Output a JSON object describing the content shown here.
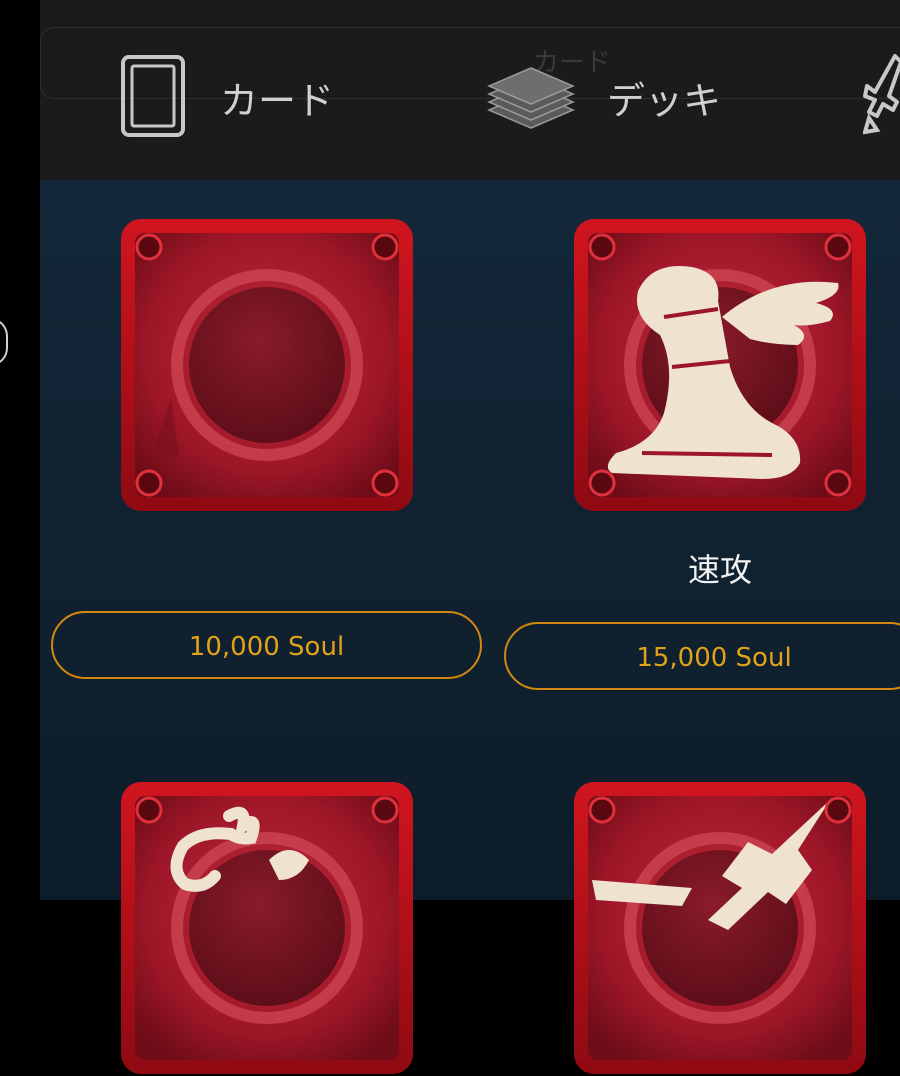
{
  "tabs": [
    {
      "label": "カード",
      "icon": "card-icon"
    },
    {
      "label": "デッキ",
      "icon": "deck-icon"
    },
    {
      "label": "",
      "icon": "sword-icon"
    }
  ],
  "search": {
    "placeholder": "カード"
  },
  "skills": [
    {
      "name": "",
      "price": "10,000 Soul",
      "icon": "blank-skill-icon"
    },
    {
      "name": "速攻",
      "price": "15,000 Soul",
      "icon": "winged-boot-icon"
    },
    {
      "name": "",
      "price": "",
      "icon": "scorpion-icon"
    },
    {
      "name": "",
      "price": "",
      "icon": "dagger-icon"
    }
  ],
  "colors": {
    "accent": "#d4880f",
    "price_text": "#e0a21b",
    "frame_red": "#b3101b",
    "background": "#102130"
  }
}
